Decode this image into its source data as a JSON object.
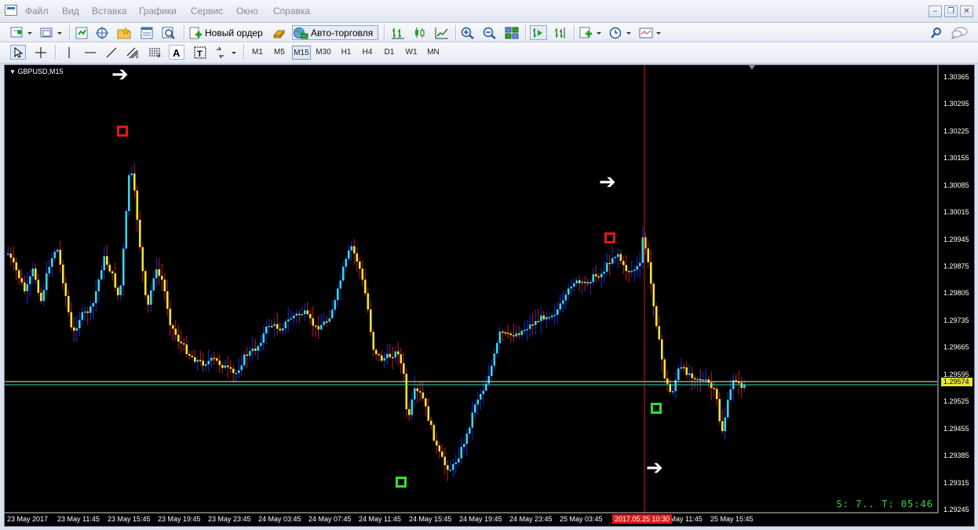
{
  "menu": {
    "items": [
      "Файл",
      "Вид",
      "Вставка",
      "Графики",
      "Сервис",
      "Окно",
      "Справка"
    ]
  },
  "window_controls": {
    "minimize": "‒",
    "restore": "❐",
    "close": "✕"
  },
  "toolbar": {
    "new_order_label": "Новый ордер",
    "autotrade_label": "Авто-торговля",
    "timeframes": [
      "M1",
      "M5",
      "M15",
      "M30",
      "H1",
      "H4",
      "D1",
      "W1",
      "MN"
    ],
    "active_timeframe": "M15"
  },
  "chart": {
    "symbol": "GBPUSD,M15",
    "price_ticks": [
      "1.30365",
      "1.30295",
      "1.30225",
      "1.30155",
      "1.30085",
      "1.30015",
      "1.29945",
      "1.29875",
      "1.29805",
      "1.29735",
      "1.29665",
      "1.29595",
      "1.29525",
      "1.29455",
      "1.29385",
      "1.29315",
      "1.29245"
    ],
    "time_ticks": [
      "23 May 2017",
      "23 May 11:45",
      "23 May 15:45",
      "23 May 19:45",
      "23 May 23:45",
      "24 May 03:45",
      "24 May 07:45",
      "24 May 11:45",
      "24 May 15:45",
      "24 May 19:45",
      "24 May 23:45",
      "25 May 03:45",
      "25 May 11:45",
      "25 May 15:45"
    ],
    "current_price": "1.29574",
    "cursor_time": "2017.05.25 10:30",
    "timer_text": "S: 7..  T: 05:46",
    "colors": {
      "background": "#000000",
      "bull": "#3ad4e6",
      "bear": "#f2e42c",
      "wick_bull": "#1b2fd8",
      "wick_bear": "#c21d1d",
      "price_line": "#f3f3c8",
      "hline": "#38d9b8",
      "vline": "#e01818",
      "sell_marker": "#e01818",
      "buy_marker": "#2ee02e"
    }
  }
}
